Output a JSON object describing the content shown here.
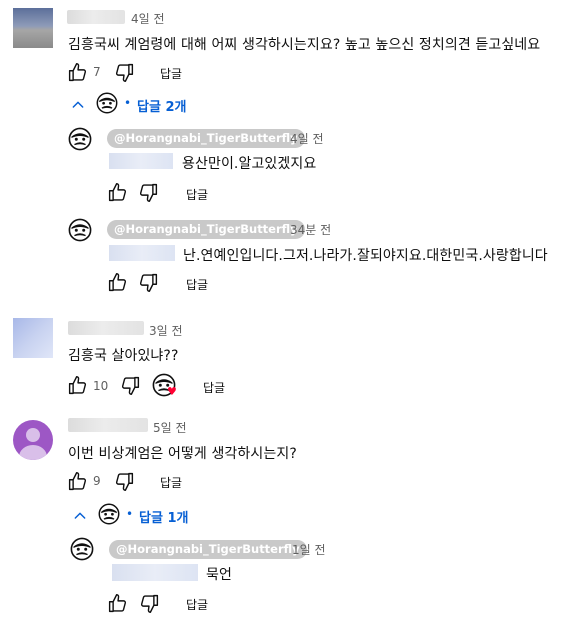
{
  "comments": [
    {
      "time": "4일 전",
      "text": "김흥국씨 계엄령에 대해 어찌 생각하시는지요? 높고 높으신 정치의견 듣고싶네요",
      "likes": "7",
      "reply_label": "답글",
      "replies_toggle": "답글 2개",
      "replies": [
        {
          "author": "@Horangnabi_TigerButterfly",
          "time": "4일 전",
          "text": "용산만이.알고있겠지요",
          "reply_label": "답글"
        },
        {
          "author": "@Horangnabi_TigerButterfly",
          "time": "34분 전",
          "text": "난.연예인입니다.그저.나라가.잘되야지요.대한민국.사랑합니다",
          "reply_label": "답글"
        }
      ]
    },
    {
      "time": "3일 전",
      "text": "김흥국 살아있냐??",
      "likes": "10",
      "reply_label": "답글"
    },
    {
      "time": "5일 전",
      "text": "이번 비상계엄은 어떻게 생각하시는지?",
      "likes": "9",
      "reply_label": "답글",
      "replies_toggle": "답글 1개",
      "replies": [
        {
          "author": "@Horangnabi_TigerButterfly",
          "time": "1일 전",
          "text": "묵언",
          "reply_label": "답글"
        }
      ]
    }
  ],
  "icons": {
    "like": "thumbs-up-icon",
    "dislike": "thumbs-down-icon",
    "creator_avatar": "masked-face-avatar-icon",
    "heart": "creator-heart-icon",
    "toggle": "chevron-up-icon"
  },
  "colors": {
    "link_blue": "#065fd4",
    "heart_red": "#ff0033",
    "chip_gray": "#c9c9c9",
    "purple_avatar": "#9d57c5"
  }
}
